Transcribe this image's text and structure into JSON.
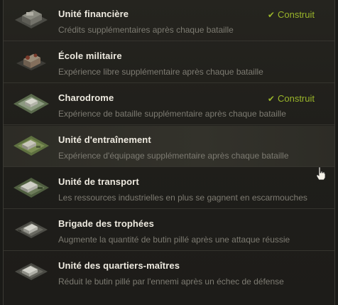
{
  "buildings": [
    {
      "title": "Unité financière",
      "desc": "Crédits supplémentaires après chaque bataille",
      "status": "Construit",
      "icon": "finance-unit-icon"
    },
    {
      "title": "École militaire",
      "desc": "Expérience libre supplémentaire après chaque bataille",
      "status": "",
      "icon": "military-school-icon"
    },
    {
      "title": "Charodrome",
      "desc": "Expérience de bataille supplémentaire après chaque bataille",
      "status": "Construit",
      "icon": "tank-range-icon"
    },
    {
      "title": "Unité d'entraînement",
      "desc": "Expérience d'équipage supplémentaire après chaque bataille",
      "status": "",
      "icon": "training-unit-icon"
    },
    {
      "title": "Unité de transport",
      "desc": "Les ressources industrielles en plus se gagnent en escarmouches",
      "status": "",
      "icon": "transport-unit-icon"
    },
    {
      "title": "Brigade des trophées",
      "desc": "Augmente la quantité de butin pillé après une attaque réussie",
      "status": "",
      "icon": "trophy-brigade-icon"
    },
    {
      "title": "Unité des quartiers-maîtres",
      "desc": "Réduit le butin pillé par l'ennemi après un échec de défense",
      "status": "",
      "icon": "quartermaster-unit-icon"
    }
  ],
  "colors": {
    "built": "#9ab52a",
    "title": "#eeeae0",
    "desc": "#7d7b72"
  }
}
